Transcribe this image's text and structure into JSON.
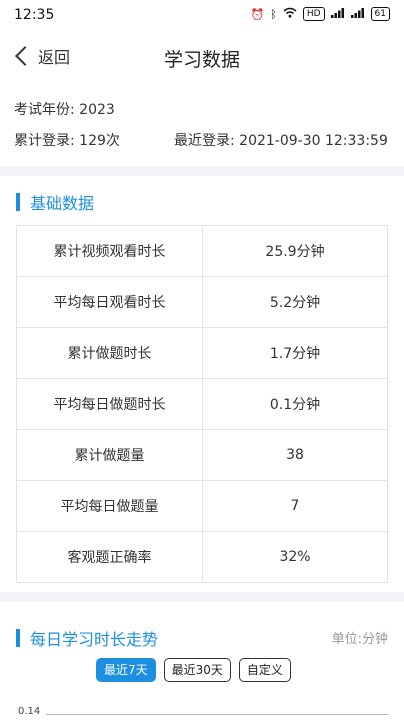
{
  "status_bar": {
    "time": "12:35",
    "icons": [
      "alarm-icon",
      "bluetooth-icon",
      "wifi-icon",
      "hd-icon",
      "signal-icon",
      "signal-icon"
    ],
    "hd_label": "HD",
    "battery": "61"
  },
  "nav": {
    "back_label": "返回",
    "title": "学习数据"
  },
  "info": {
    "exam_year": "考试年份: 2023",
    "total_logins": "累计登录: 129次",
    "recent_login": "最近登录: 2021-09-30 12:33:59"
  },
  "basic": {
    "title": "基础数据",
    "rows": [
      {
        "label": "累计视频观看时长",
        "value": "25.9分钟"
      },
      {
        "label": "平均每日观看时长",
        "value": "5.2分钟"
      },
      {
        "label": "累计做题时长",
        "value": "1.7分钟"
      },
      {
        "label": "平均每日做题时长",
        "value": "0.1分钟"
      },
      {
        "label": "累计做题量",
        "value": "38"
      },
      {
        "label": "平均每日做题量",
        "value": "7"
      },
      {
        "label": "客观题正确率",
        "value": "32%"
      }
    ]
  },
  "trend": {
    "title": "每日学习时长走势",
    "unit": "单位:分钟",
    "filters": [
      "最近7天",
      "最近30天",
      "自定义"
    ],
    "active_filter": "最近7天",
    "y_tick_top": "0.14"
  },
  "colors": {
    "accent": "#1d8fe0",
    "background": "#f2f4f7"
  }
}
